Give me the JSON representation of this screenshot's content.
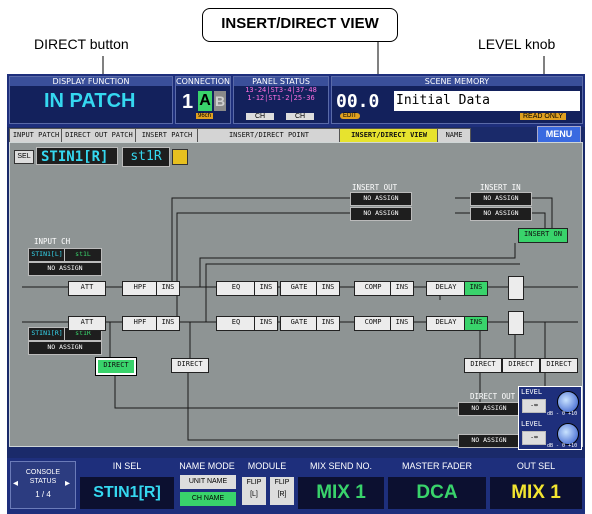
{
  "callouts": {
    "direct_button": "DIRECT button",
    "view_title": "INSERT/DIRECT VIEW",
    "level_knob": "LEVEL knob"
  },
  "header": {
    "display_function_title": "DISPLAY FUNCTION",
    "display_function_value": "IN PATCH",
    "connection_title": "CONNECTION",
    "connection_num": "1",
    "connection_a": "A",
    "connection_b": "B",
    "connection_sub": "96ch",
    "panel_status_title": "PANEL STATUS",
    "panel_status_line1": "13-24|ST3-4|37-48",
    "panel_status_line2": "1-12|ST1-2|25-36",
    "panel_status_ch1": "CH",
    "panel_status_ch2": "CH",
    "scene_memory_title": "SCENE MEMORY",
    "scene_number": "00.0",
    "scene_name": "Initial Data",
    "edit_badge": "EDIT",
    "read_only_badge": "READ ONLY"
  },
  "tabs": [
    {
      "label": "INPUT PATCH"
    },
    {
      "label": "DIRECT OUT PATCH"
    },
    {
      "label": "INSERT PATCH"
    },
    {
      "label": "INSERT/DIRECT POINT"
    },
    {
      "label": "INSERT/DIRECT VIEW"
    },
    {
      "label": "NAME"
    }
  ],
  "menu_label": "MENU",
  "channel": {
    "sel_label": "SEL",
    "name": "STIN1[R]",
    "short_name": "st1R"
  },
  "diagram": {
    "insert_out_label": "INSERT OUT",
    "insert_in_label": "INSERT IN",
    "no_assign": "NO ASSIGN",
    "insert_on": "INSERT ON",
    "input_ch_label": "INPUT CH",
    "ch_left_port": "STIN1[L]",
    "ch_left_name": "st1L",
    "ch_right_port": "STIN1[R]",
    "ch_right_name": "st1R",
    "att": "ATT",
    "hpf": "HPF",
    "ins": "INS",
    "eq": "EQ",
    "gate": "GATE",
    "comp": "COMP",
    "delay": "DELAY",
    "direct": "DIRECT",
    "direct_out_label": "DIRECT OUT",
    "level_label": "LEVEL",
    "level_value": "-∞",
    "level_scale": "dB - 0 +10"
  },
  "footer": {
    "console_status_label": "CONSOLE STATUS",
    "console_status_page": "1 / 4",
    "in_sel_title": "IN SEL",
    "in_sel_value": "STIN1[R]",
    "name_mode_title": "NAME MODE",
    "unit_name": "UNIT NAME",
    "ch_name": "CH NAME",
    "module_title": "MODULE",
    "flip_l": "FLIP [L]",
    "flip_r": "FLIP [R]",
    "mix_send_title": "MIX SEND NO.",
    "mix_send_value": "MIX 1",
    "master_fader_title": "MASTER FADER",
    "master_fader_value": "DCA",
    "out_sel_title": "OUT SEL",
    "out_sel_value": "MIX 1"
  },
  "colors": {
    "panel_blue": "#1e2f7c",
    "cyan": "#35d8f0",
    "green": "#39d36b",
    "yellow_tab": "#e7e32e",
    "out_sel_yellow": "#f2e530"
  }
}
